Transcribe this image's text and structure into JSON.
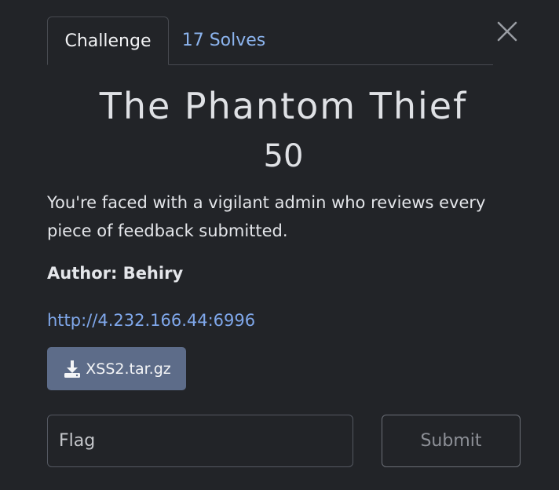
{
  "tabs": {
    "challenge_label": "Challenge",
    "solves_label": "17 Solves"
  },
  "challenge": {
    "name": "The Phantom Thief",
    "points": "50",
    "description": "You're faced with a vigilant admin who reviews every piece of feedback submitted.",
    "author": "Author: Behiry",
    "url": "http://4.232.166.44:6996",
    "file_name": "XSS2.tar.gz"
  },
  "form": {
    "flag_placeholder": "Flag",
    "submit_label": "Submit"
  },
  "icons": {
    "close": "close-icon",
    "download": "download-icon"
  },
  "colors": {
    "background": "#222428",
    "link": "#7fa7ea",
    "file_button": "#5d6c89"
  }
}
